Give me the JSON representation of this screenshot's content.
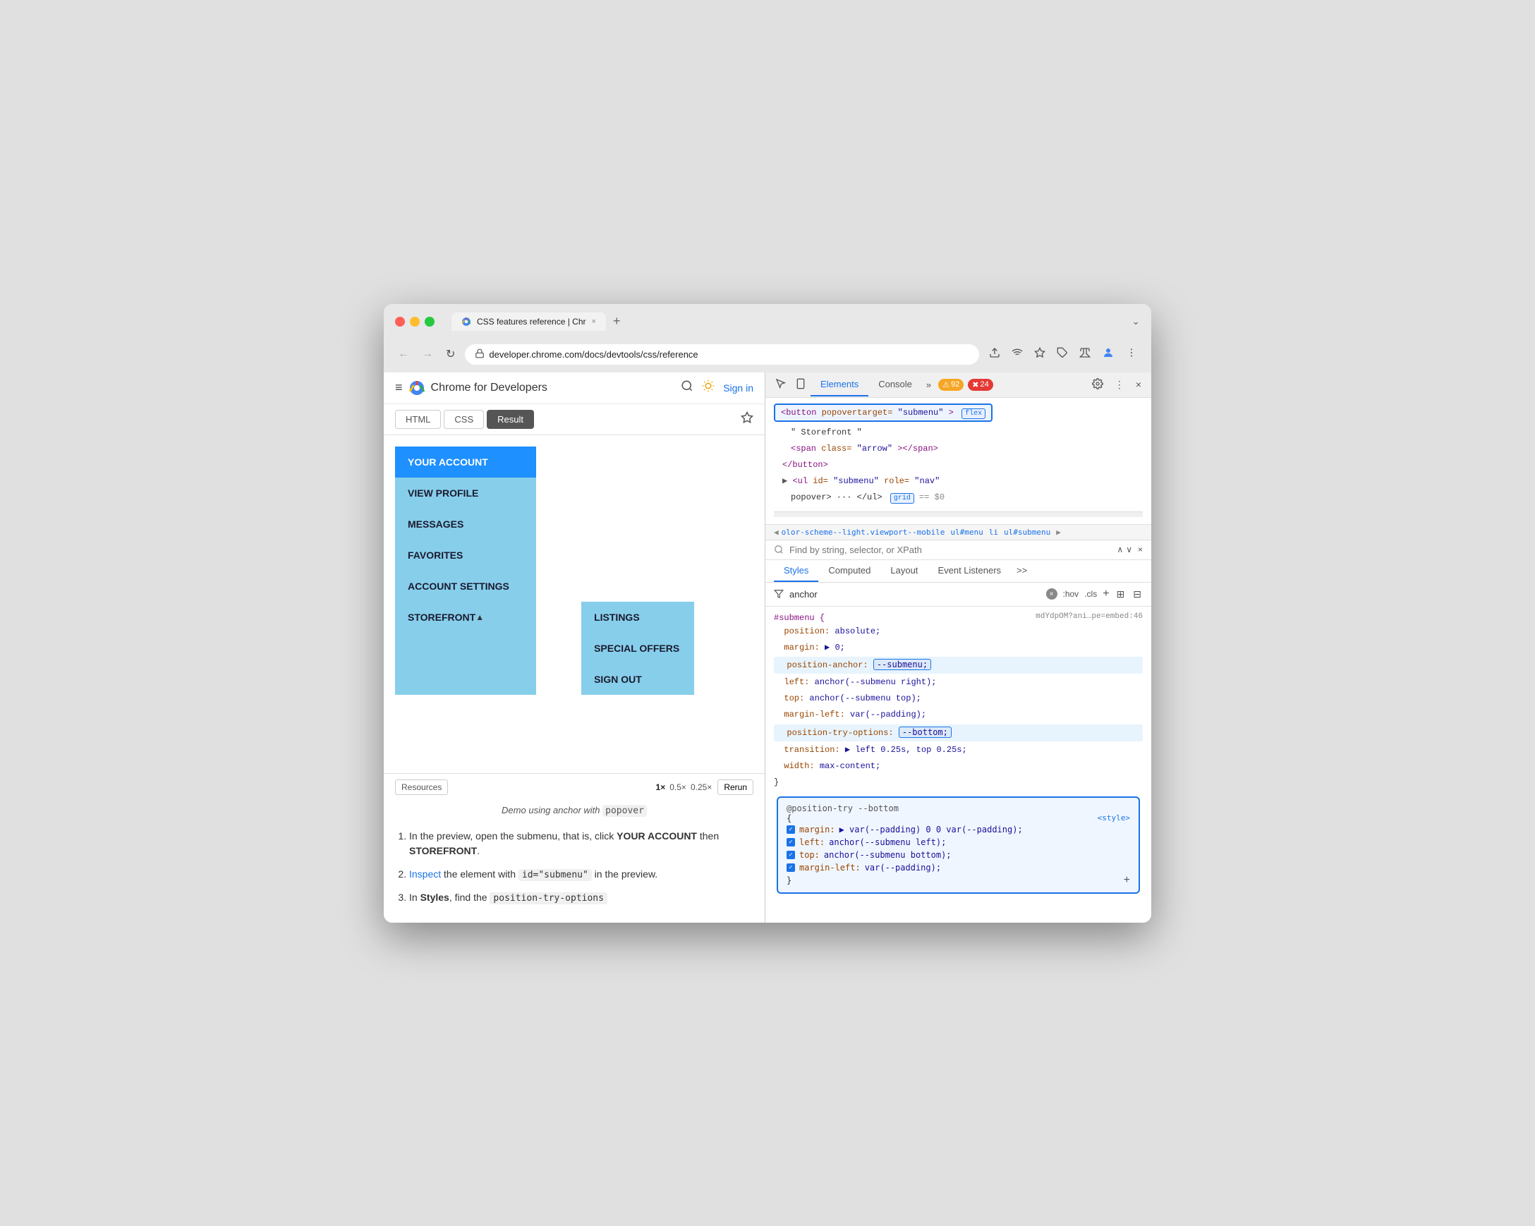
{
  "browser": {
    "title": "CSS features reference | Chr",
    "url": "developer.chrome.com/docs/devtools/css/reference",
    "tab_close": "×",
    "tab_new": "+",
    "down_arrow": "⌄"
  },
  "nav": {
    "back": "←",
    "forward": "→",
    "refresh": "↻",
    "security_icon": "🔒"
  },
  "address_bar_icons": {
    "screenshot": "⬆",
    "eye_slash": "👁",
    "star": "☆",
    "extensions": "🧩",
    "beaker": "⚗",
    "profile": "👤",
    "menu": "⋮"
  },
  "cfd_header": {
    "title": "Chrome for Developers",
    "search_icon": "🔍",
    "theme_icon": "🌞",
    "sign_in": "Sign in"
  },
  "code_tabs": {
    "html": "HTML",
    "css": "CSS",
    "result": "Result",
    "settings_icon": "⚙"
  },
  "account_menu": {
    "header": "YOUR ACCOUNT",
    "items": [
      {
        "label": "VIEW PROFILE"
      },
      {
        "label": "MESSAGES"
      },
      {
        "label": "FAVORITES"
      },
      {
        "label": "ACCOUNT SETTINGS"
      },
      {
        "label": "STOREFRONT",
        "has_arrow": true
      }
    ],
    "submenu": {
      "items": [
        {
          "label": "LISTINGS"
        },
        {
          "label": "SPECIAL OFFERS"
        },
        {
          "label": "SIGN OUT"
        }
      ]
    }
  },
  "preview_controls": {
    "resources": "Resources",
    "zoom_1x": "1×",
    "zoom_05x": "0.5×",
    "zoom_025x": "0.25×",
    "rerun": "Rerun"
  },
  "demo_caption": "Demo using anchor with",
  "demo_code_word": "popover",
  "instructions": {
    "items": [
      {
        "id": 1,
        "text_before": "In the preview, open the submenu, that is, click ",
        "bold1": "YOUR ACCOUNT",
        "text_mid": " then ",
        "bold2": "STOREFRONT",
        "text_after": "."
      },
      {
        "id": 2,
        "link": "Inspect",
        "text_mid": " the element with ",
        "code": "id=\"submenu\"",
        "text_after": " in the preview."
      },
      {
        "id": 3,
        "text_before": "In ",
        "bold": "Styles",
        "text_after": ", find the ",
        "code": "position-try-options"
      }
    ]
  },
  "devtools": {
    "panel_icon1": "⬚",
    "panel_icon2": "⬛",
    "tabs": [
      "Elements",
      "Console"
    ],
    "more_icon": "»",
    "badge_warning_count": "92",
    "badge_error_count": "24",
    "settings_icon": "⚙",
    "more_dots": "⋮",
    "close": "×"
  },
  "elements_panel": {
    "html_lines": [
      {
        "type": "selected",
        "content": "<button popovertarget=\"submenu\">",
        "badge": "flex"
      },
      {
        "indent": 2,
        "content": "\" Storefront \""
      },
      {
        "indent": 2,
        "tag": "<span",
        "attr": " class=",
        "value": "\"arrow\"",
        "close": "></span>"
      },
      {
        "indent": 1,
        "close_tag": "</button>"
      },
      {
        "indent": 1,
        "tag": "▶ <ul",
        "attr": " id=",
        "value": "\"submenu\"",
        "attr2": " role=",
        "value2": "\"nav\""
      },
      {
        "indent": 2,
        "content": "popover> ··· </ul>",
        "badge": "grid",
        "suffix": "== $0"
      }
    ]
  },
  "breadcrumb": {
    "items": [
      "olor-scheme--light.viewport--mobile",
      "ul#menu",
      "li",
      "ul#submenu"
    ]
  },
  "filter": {
    "placeholder": "Find by string, selector, or XPath"
  },
  "styles_tabs": {
    "tabs": [
      "Styles",
      "Computed",
      "Layout",
      "Event Listeners"
    ],
    "more": ">>"
  },
  "styles_filter": {
    "filter_icon": "≡",
    "placeholder": "anchor",
    "clear_icon": "×",
    "hov": ":hov",
    "cls": ".cls",
    "plus": "+",
    "icon2": "⊞",
    "icon3": "⊟"
  },
  "css_block": {
    "selector": "#submenu {",
    "source": "mdYdpOM?ani…pe=embed:46",
    "properties": [
      {
        "prop": "position:",
        "value": "absolute;"
      },
      {
        "prop": "margin:",
        "value": "▶ 0;"
      },
      {
        "prop": "position-anchor:",
        "value": "--submenu;",
        "highlighted": true
      },
      {
        "prop": "left:",
        "value": "anchor(--submenu right);"
      },
      {
        "prop": "top:",
        "value": "anchor(--submenu top);"
      },
      {
        "prop": "margin-left:",
        "value": "var(--padding);"
      },
      {
        "prop": "position-try-options:",
        "value": "--bottom;",
        "highlighted": true
      },
      {
        "prop": "transition:",
        "value": "▶ left 0.25s, top 0.25s;"
      },
      {
        "prop": "width:",
        "value": "max-content;"
      }
    ],
    "close": "}"
  },
  "position_try_block": {
    "header": "@position-try --bottom",
    "source": "<style>",
    "open": "{",
    "properties": [
      {
        "prop": "margin:",
        "value": "▶ var(--padding) 0 0 var(--padding);"
      },
      {
        "prop": "left:",
        "value": "anchor(--submenu left);"
      },
      {
        "prop": "top:",
        "value": "anchor(--submenu bottom);"
      },
      {
        "prop": "margin-left:",
        "value": "var(--padding);"
      }
    ],
    "close": "}"
  },
  "colors": {
    "accent_blue": "#1a73e8",
    "menu_header_bg": "#1e90ff",
    "menu_items_bg": "#87ceeb",
    "submenu_bg": "#87ceeb",
    "selected_html_bg": "#dce9f8",
    "highlighted_css_bg": "#e8f4fd",
    "position_try_border": "#1a73e8",
    "badge_warning_bg": "#f5a623",
    "badge_error_bg": "#e53935"
  }
}
